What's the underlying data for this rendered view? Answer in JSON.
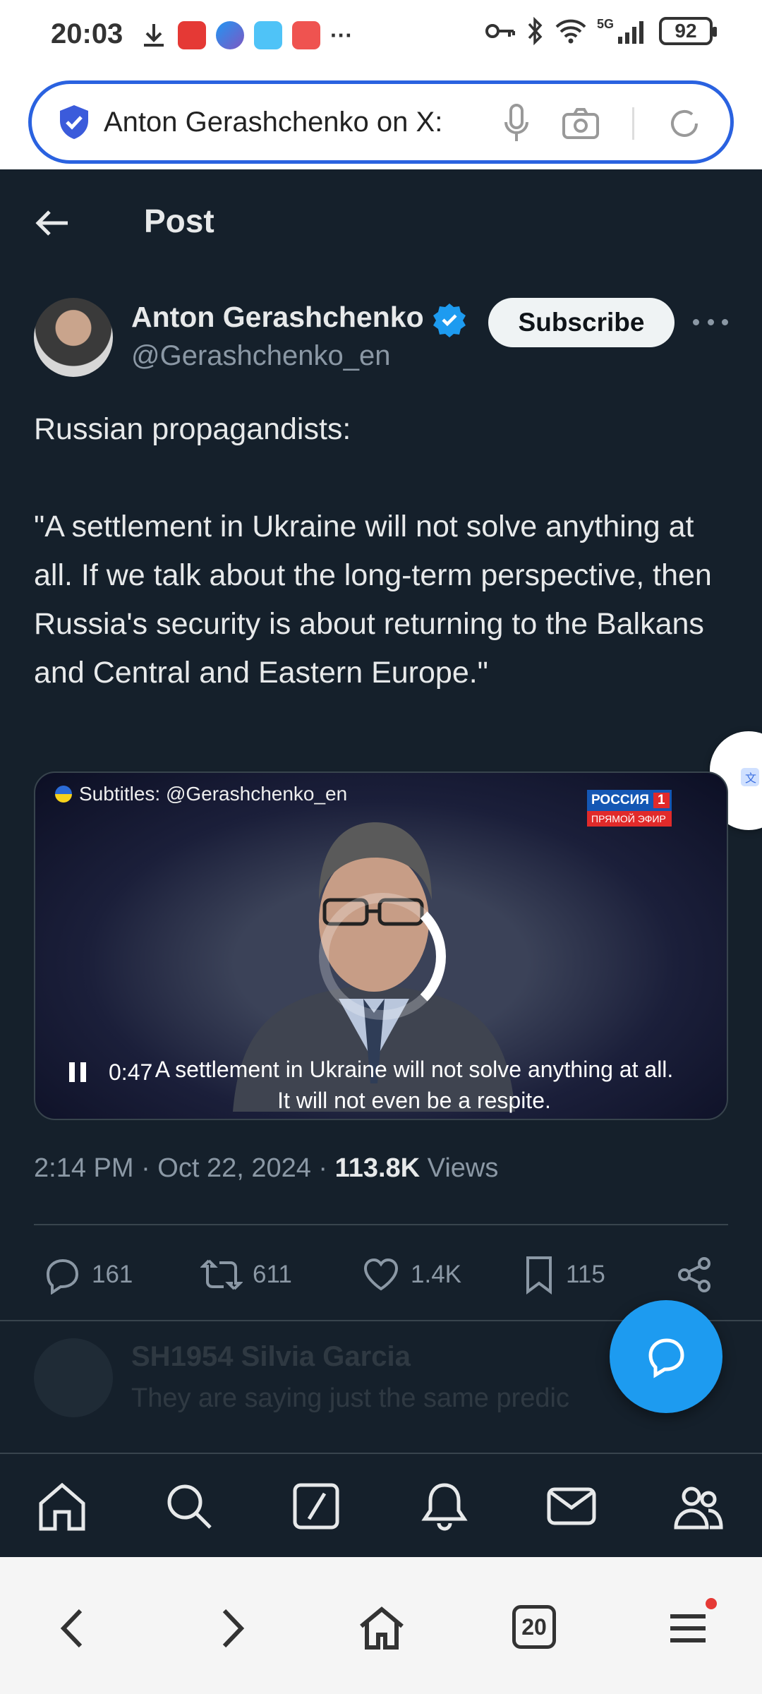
{
  "status_bar": {
    "time": "20:03",
    "network": "5G",
    "battery": "92",
    "more": "···"
  },
  "browser": {
    "url_text": "Anton Gerashchenko on X:",
    "tabs_count": "20"
  },
  "header": {
    "title": "Post"
  },
  "post": {
    "author_name": "Anton Gerashchenko",
    "author_handle": "@Gerashchenko_en",
    "subscribe_label": "Subscribe",
    "text": "Russian propagandists:\n\n\"A settlement in Ukraine will not solve anything at all. If we talk about the long-term perspective, then Russia's security is about returning to the Balkans and Central and Eastern Europe.\"",
    "video": {
      "subtitles_credit": "Subtitles: @Gerashchenko_en",
      "channel_name": "РОССИЯ",
      "channel_number": "1",
      "channel_live": "ПРЯМОЙ ЭФИР",
      "time": "0:47",
      "subtitle_line1": "A settlement in Ukraine will not solve anything at all.",
      "subtitle_line2": "It will not even be a respite."
    },
    "timestamp": "2:14 PM · Oct 22, 2024 · ",
    "views_count": "113.8K",
    "views_label": " Views",
    "stats": {
      "replies": "161",
      "reposts": "611",
      "likes": "1.4K",
      "bookmarks": "115"
    }
  },
  "reply_preview": {
    "name": "SH1954 Silvia Garcia",
    "text": "They are saying just the same predic"
  },
  "colors": {
    "background": "#15202b",
    "accent": "#1d9bf0",
    "text_primary": "#e7e9ea",
    "text_secondary": "#8b98a5"
  }
}
